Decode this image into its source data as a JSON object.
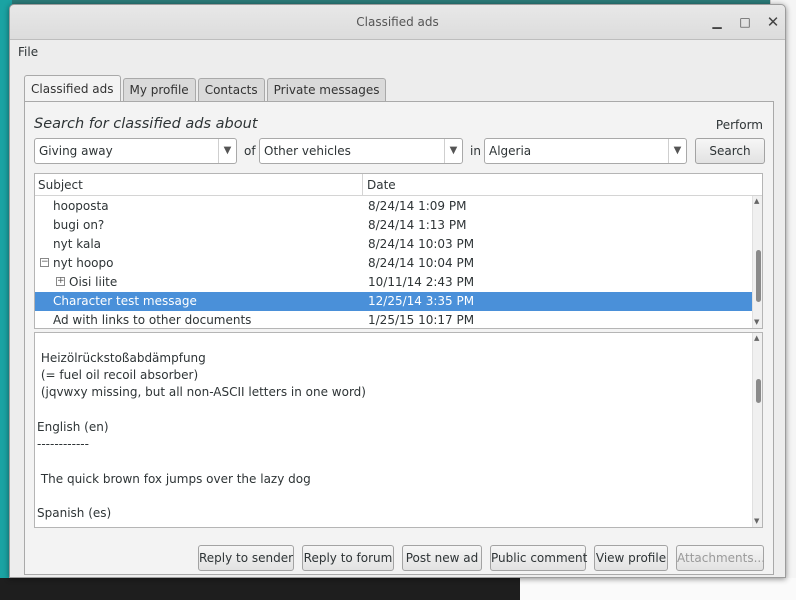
{
  "window": {
    "title": "Classified ads"
  },
  "menu": {
    "file": "File"
  },
  "tabs": [
    "Classified ads",
    "My profile",
    "Contacts",
    "Private messages"
  ],
  "search": {
    "heading": "Search for classified ads about",
    "perform_label": "Perform",
    "action_value": "Giving away",
    "of_label": "of",
    "category_value": "Other vehicles",
    "in_label": "in",
    "location_value": "Algeria",
    "search_button": "Search"
  },
  "table": {
    "headers": [
      "Subject",
      "Date"
    ],
    "rows": [
      {
        "subject": "hooposta",
        "date": "8/24/14 1:09 PM"
      },
      {
        "subject": "bugi on?",
        "date": "8/24/14 1:13 PM"
      },
      {
        "subject": "nyt kala",
        "date": "8/24/14 10:03 PM"
      },
      {
        "subject": "nyt hoopo",
        "date": "8/24/14 10:04 PM",
        "expander": "−"
      },
      {
        "subject": "Oisi liite",
        "date": "10/11/14 2:43 PM",
        "expander": "+"
      },
      {
        "subject": "Character test message",
        "date": "12/25/14 3:35 PM",
        "selected": true
      },
      {
        "subject": "Ad with links to other documents",
        "date": "1/25/15 10:17 PM"
      }
    ]
  },
  "message": {
    "lines": [
      " Heizölrückstoßabdämpfung",
      " (= fuel oil recoil absorber)",
      " (jqvwxy missing, but all non-ASCII letters in one word)",
      "English (en)",
      "------------",
      " The quick brown fox jumps over the lazy dog",
      "Spanish (es)"
    ]
  },
  "actions": {
    "reply_to_sender": "Reply to sender",
    "reply_to_forum": "Reply to forum",
    "post_new_ad": "Post new ad",
    "public_comment": "Public comment",
    "view_profile": "View profile",
    "attachments": "Attachments..."
  },
  "icons": {
    "dropdown": "chevron-down-icon",
    "expander_open": "minus-box-icon",
    "expander_closed": "plus-box-icon"
  },
  "colors": {
    "selection": "#4a90d9",
    "window_bg": "#ededed"
  }
}
